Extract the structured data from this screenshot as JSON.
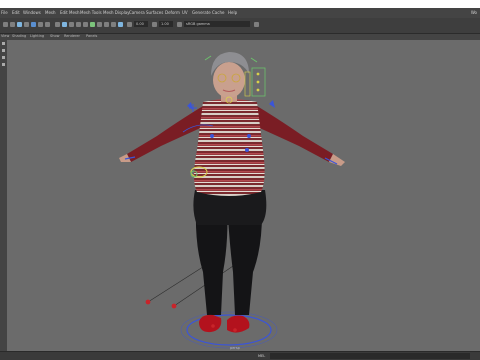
{
  "menus": [
    "File",
    "Edit",
    "Windows",
    "Mesh",
    "Edit Mesh",
    "Mesh Tools",
    "Mesh Display",
    "Camera",
    "Surfaces",
    "Deform",
    "UV",
    "Generate",
    "Cache",
    "Help"
  ],
  "menu_right": "Wo",
  "toolbar": {
    "num_a": "0.00",
    "num_b": "1.00",
    "colorspace": "sRGB gamma"
  },
  "panels": [
    "View",
    "Shading",
    "Lighting",
    "Show",
    "Renderer",
    "Panels"
  ],
  "viewport": {
    "persp_label": "persp"
  },
  "status": {
    "mel_label": "MEL"
  },
  "colors": {
    "accent": "#7fb6e0",
    "rig_blue": "#3b55d8",
    "rig_yellow": "#d9d24a",
    "rig_green": "#6cc16c",
    "rig_red": "#c8242a",
    "sweater_base": "#7a2a2e"
  }
}
